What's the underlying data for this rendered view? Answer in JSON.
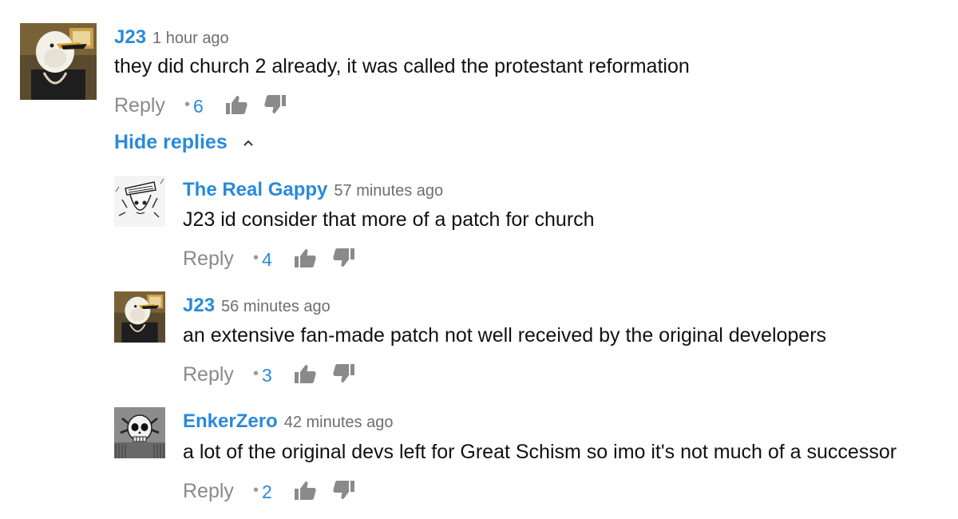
{
  "comments": [
    {
      "author": "J23",
      "time": "1 hour ago",
      "text": "they did church 2 already, it was called the protestant reformation",
      "reply_label": "Reply",
      "likes": "6",
      "avatar_icon": "eagle-mask-avatar"
    }
  ],
  "hide_replies_label": "Hide replies",
  "replies": [
    {
      "author": "The Real Gappy",
      "time": "57 minutes ago",
      "text": "J23 id consider that more of a patch for church",
      "reply_label": "Reply",
      "likes": "4",
      "avatar_icon": "manga-sailor-avatar"
    },
    {
      "author": "J23",
      "time": "56 minutes ago",
      "text": "an extensive fan-made patch not well received by the original developers",
      "reply_label": "Reply",
      "likes": "3",
      "avatar_icon": "eagle-mask-avatar"
    },
    {
      "author": "EnkerZero",
      "time": "42 minutes ago",
      "text": "a lot of the original devs left for Great Schism so imo it's not much of a successor",
      "reply_label": "Reply",
      "likes": "2",
      "avatar_icon": "skull-avatar"
    }
  ],
  "colors": {
    "link_blue": "#2a8ad9",
    "muted_gray": "#8a8a8a",
    "text": "#111111"
  }
}
